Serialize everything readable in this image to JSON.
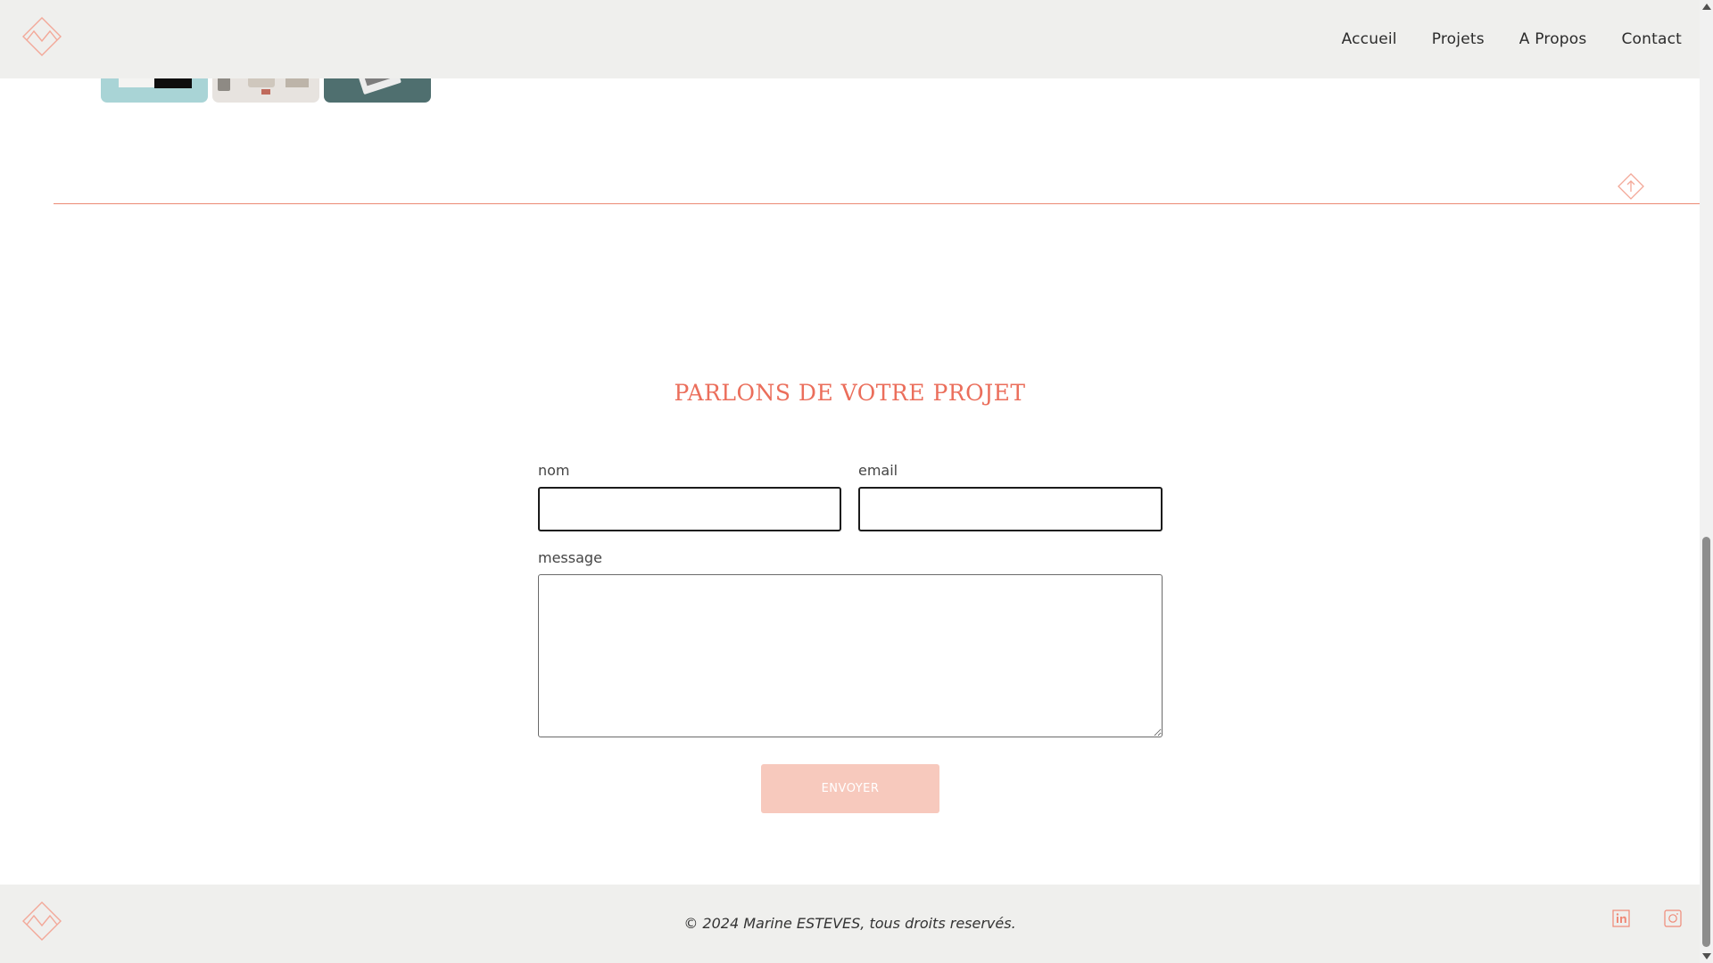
{
  "nav": {
    "items": [
      {
        "label": "Accueil"
      },
      {
        "label": "Projets"
      },
      {
        "label": "A Propos"
      },
      {
        "label": "Contact"
      }
    ]
  },
  "contact": {
    "title": "PARLONS DE VOTRE PROJET",
    "name_label": "nom",
    "name_value": "",
    "email_label": "email",
    "email_value": "",
    "message_label": "message",
    "message_value": "",
    "submit_label": "ENVOYER"
  },
  "footer": {
    "copyright": "© 2024 Marine ESTEVES, tous droits reservés.",
    "social": [
      {
        "icon": "linkedin-icon"
      },
      {
        "icon": "instagram-icon"
      }
    ]
  },
  "colors": {
    "accent": "#eb6e5b",
    "divider": "#ec8a74",
    "button": "#f7c9bd",
    "header_bg": "#efefed"
  }
}
